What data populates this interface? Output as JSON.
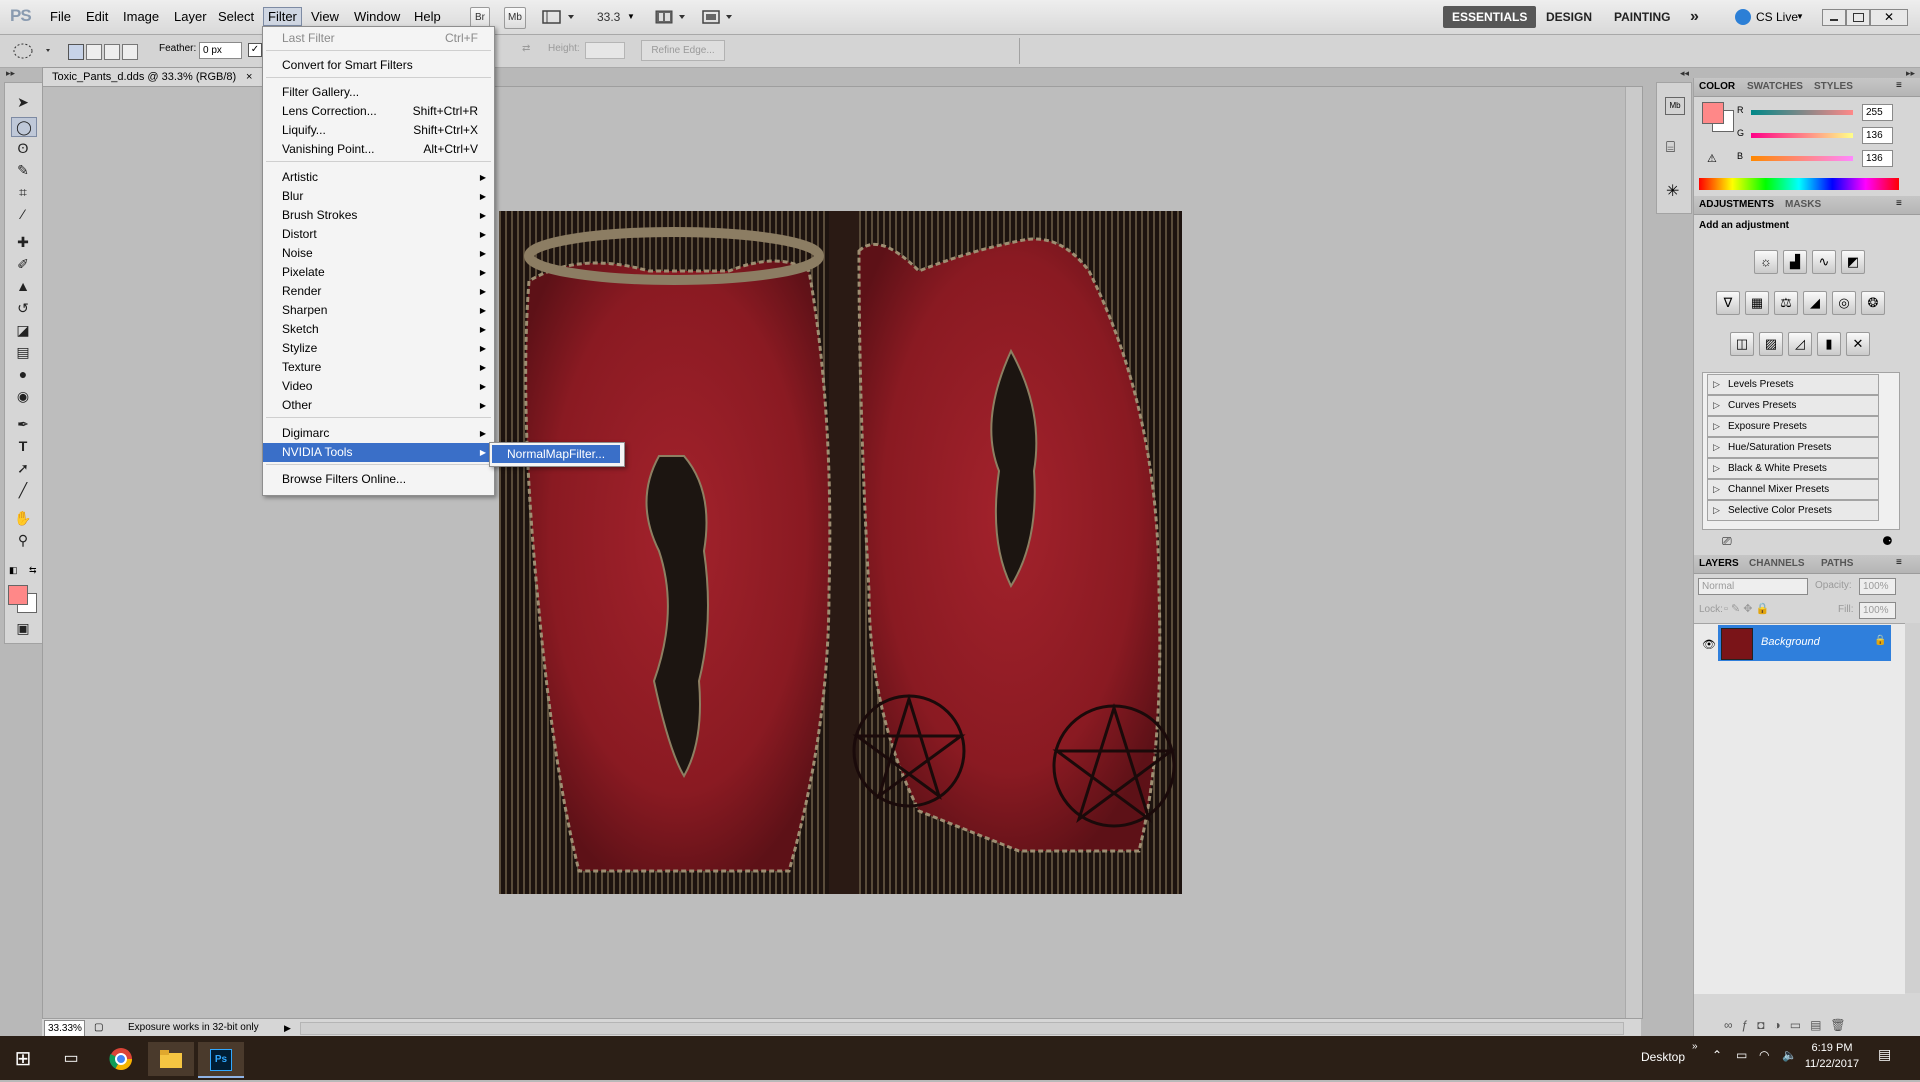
{
  "app": {
    "logo": "PS"
  },
  "menubar": {
    "items": [
      "File",
      "Edit",
      "Image",
      "Layer",
      "Select",
      "Filter",
      "View",
      "Window",
      "Help"
    ],
    "active": "Filter",
    "bridge_label": "Br",
    "minibridge_label": "Mb",
    "zoom": "33.3",
    "workspaces": [
      "ESSENTIALS",
      "DESIGN",
      "PAINTING"
    ],
    "more": "»",
    "cslive": "CS Live"
  },
  "options": {
    "feather_label": "Feather:",
    "feather_value": "0 px",
    "height_label": "Height:",
    "refine_edge": "Refine Edge..."
  },
  "document": {
    "tab_title": "Toxic_Pants_d.dds @ 33.3% (RGB/8)",
    "tab_close": "×",
    "status_zoom": "33.33%",
    "status_text": "Exposure works in 32-bit only"
  },
  "filter_menu": {
    "items": [
      {
        "label": "Last Filter",
        "shortcut": "Ctrl+F",
        "disabled": true
      },
      {
        "label": "Convert for Smart Filters"
      },
      {
        "label": "Filter Gallery..."
      },
      {
        "label": "Lens Correction...",
        "shortcut": "Shift+Ctrl+R"
      },
      {
        "label": "Liquify...",
        "shortcut": "Shift+Ctrl+X"
      },
      {
        "label": "Vanishing Point...",
        "shortcut": "Alt+Ctrl+V"
      },
      {
        "label": "Artistic",
        "submenu": true
      },
      {
        "label": "Blur",
        "submenu": true
      },
      {
        "label": "Brush Strokes",
        "submenu": true
      },
      {
        "label": "Distort",
        "submenu": true
      },
      {
        "label": "Noise",
        "submenu": true
      },
      {
        "label": "Pixelate",
        "submenu": true
      },
      {
        "label": "Render",
        "submenu": true
      },
      {
        "label": "Sharpen",
        "submenu": true
      },
      {
        "label": "Sketch",
        "submenu": true
      },
      {
        "label": "Stylize",
        "submenu": true
      },
      {
        "label": "Texture",
        "submenu": true
      },
      {
        "label": "Video",
        "submenu": true
      },
      {
        "label": "Other",
        "submenu": true
      },
      {
        "label": "Digimarc",
        "submenu": true
      },
      {
        "label": "NVIDIA Tools",
        "submenu": true,
        "highlighted": true
      },
      {
        "label": "Browse Filters Online..."
      }
    ],
    "submenu_item": "NormalMapFilter..."
  },
  "color_panel": {
    "tabs": [
      "COLOR",
      "SWATCHES",
      "STYLES"
    ],
    "r_label": "R",
    "r_value": "255",
    "g_label": "G",
    "g_value": "136",
    "b_label": "B",
    "b_value": "136",
    "foreground_color": "#ff8888"
  },
  "adjustments_panel": {
    "tabs": [
      "ADJUSTMENTS",
      "MASKS"
    ],
    "heading": "Add an adjustment",
    "presets": [
      "Levels Presets",
      "Curves Presets",
      "Exposure Presets",
      "Hue/Saturation Presets",
      "Black & White Presets",
      "Channel Mixer Presets",
      "Selective Color Presets"
    ]
  },
  "layers_panel": {
    "tabs": [
      "LAYERS",
      "CHANNELS",
      "PATHS"
    ],
    "blend_mode": "Normal",
    "opacity_label": "Opacity:",
    "opacity_value": "100%",
    "lock_label": "Lock:",
    "fill_label": "Fill:",
    "fill_value": "100%",
    "layer_name": "Background"
  },
  "taskbar": {
    "desktop_label": "Desktop",
    "time": "6:19 PM",
    "date": "11/22/2017",
    "ps_label": "Ps"
  }
}
